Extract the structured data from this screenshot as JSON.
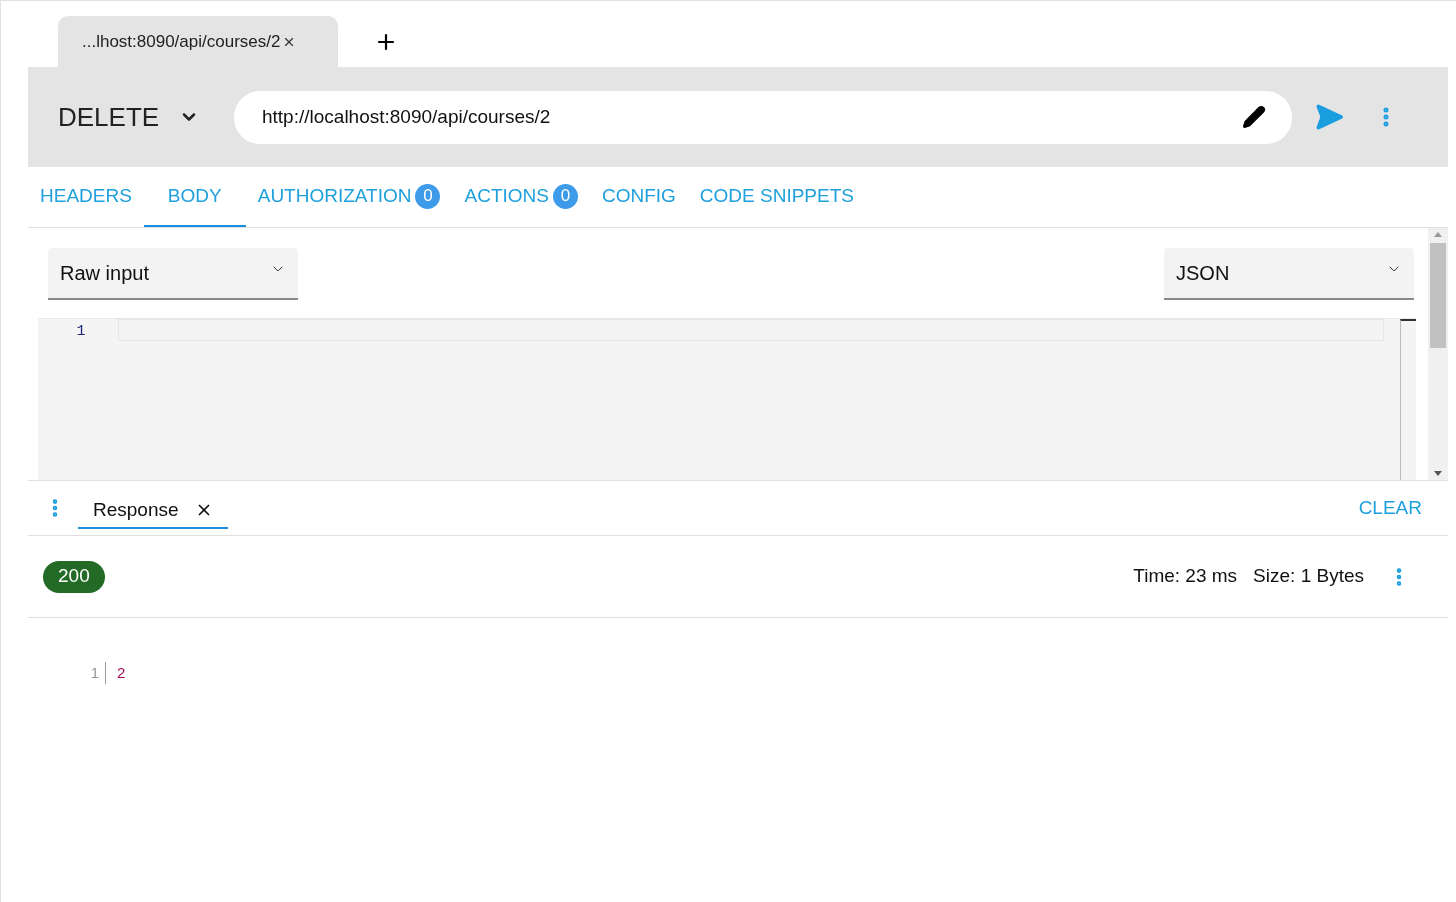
{
  "request_tabs": [
    {
      "title": "...lhost:8090/api/courses/2",
      "selected": true
    }
  ],
  "method": "DELETE",
  "url": "http://localhost:8090/api/courses/2",
  "tabs": [
    {
      "label": "HEADERS",
      "selected": false
    },
    {
      "label": "BODY",
      "selected": true
    },
    {
      "label": "AUTHORIZATION",
      "badge": "0",
      "selected": false
    },
    {
      "label": "ACTIONS",
      "badge": "0",
      "selected": false
    },
    {
      "label": "CONFIG",
      "selected": false
    },
    {
      "label": "CODE SNIPPETS",
      "selected": false
    }
  ],
  "body": {
    "input_type": "Raw input",
    "format": "JSON",
    "editor_lines": [
      "1"
    ]
  },
  "response": {
    "tab": "Response",
    "clear": "CLEAR",
    "status": "200",
    "time": "Time: 23 ms",
    "size": "Size: 1 Bytes",
    "lines": [
      {
        "number": "1",
        "text": "2"
      }
    ]
  }
}
